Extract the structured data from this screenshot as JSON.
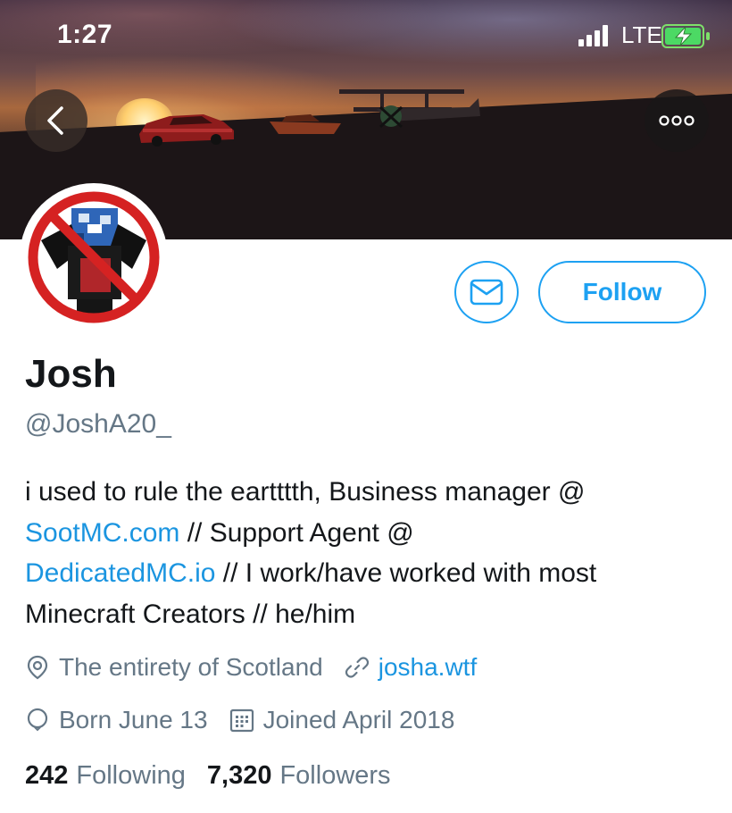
{
  "status_bar": {
    "time": "1:27",
    "network": "LTE"
  },
  "profile": {
    "display_name": "Josh",
    "handle": "@JoshA20_",
    "bio": {
      "line1": "i used to rule the eartttth, Business manager @",
      "link1": "SootMC.com",
      "text2": " // Support Agent @",
      "link2": "DedicatedMC.io",
      "text3": " // I work/have worked with most Minecraft Creators // he/him"
    },
    "location": "The entirety of Scotland",
    "website": "josha.wtf",
    "birthday": "Born June 13",
    "joined": "Joined April 2018",
    "following_count": "242",
    "following_label": "Following",
    "followers_count": "7,320",
    "followers_label": "Followers"
  },
  "actions": {
    "follow_label": "Follow"
  },
  "colors": {
    "accent": "#1da1f2",
    "link": "#1b95e0",
    "secondary_text": "#657786",
    "primary_text": "#14171a"
  },
  "icons": {
    "back": "chevron-left-icon",
    "more": "more-dots-icon",
    "message": "envelope-icon",
    "location": "map-pin-icon",
    "website": "link-icon",
    "birthday": "balloon-icon",
    "joined": "calendar-icon"
  }
}
